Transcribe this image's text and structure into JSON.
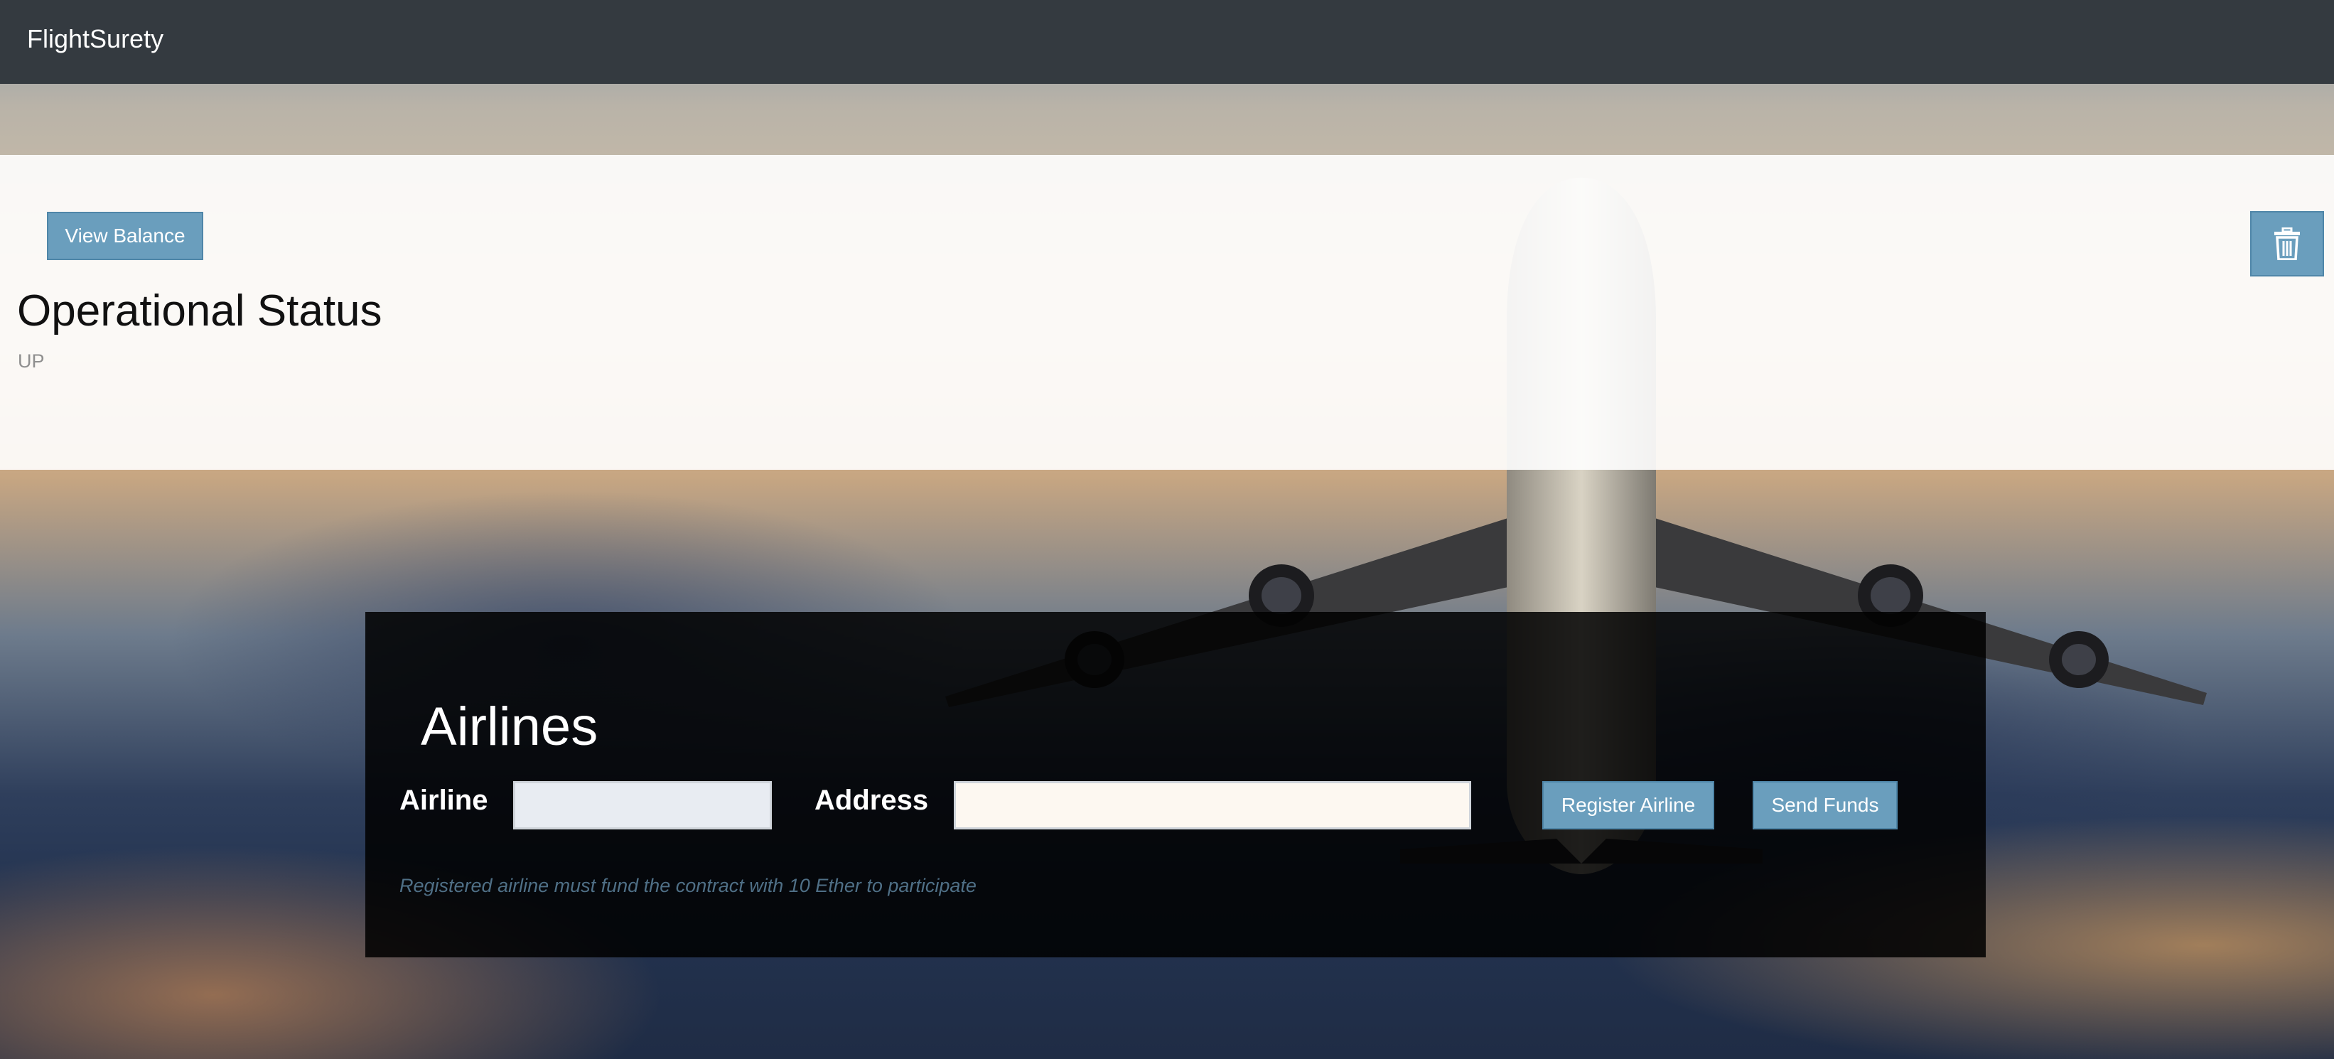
{
  "navbar": {
    "brand": "FlightSurety"
  },
  "status_panel": {
    "view_balance_label": "View Balance",
    "trash_icon": "trash-icon",
    "title": "Operational Status",
    "status_value": "UP"
  },
  "airlines_panel": {
    "title": "Airlines",
    "airline_label": "Airline",
    "airline_value": "",
    "address_label": "Address",
    "address_value": "",
    "register_label": "Register Airline",
    "send_funds_label": "Send Funds",
    "note": "Registered airline must fund the contract with 10 Ether to participate"
  },
  "colors": {
    "navbar": "#343a40",
    "button": "#6a9ebd",
    "note_text": "#4f6f86"
  }
}
